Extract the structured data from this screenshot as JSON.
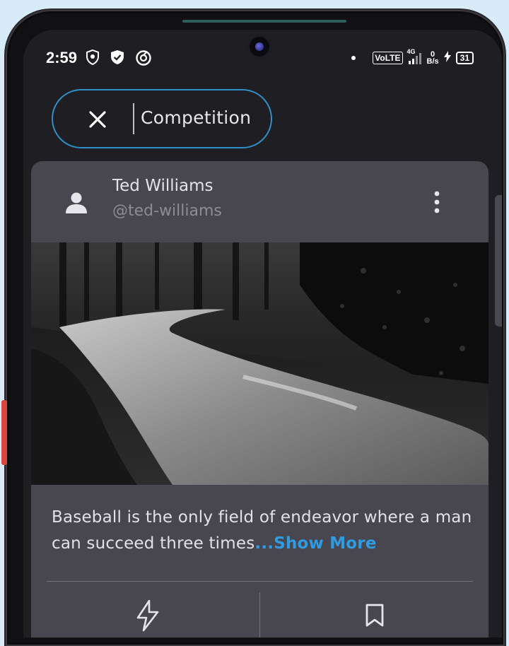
{
  "status_bar": {
    "time": "2:59",
    "network": "VoLTE",
    "signal_label": "4G",
    "net_speed_value": "0",
    "net_speed_unit": "B/s",
    "battery": "31",
    "icons": [
      "shield-icon",
      "verified-shield-icon",
      "sync-icon",
      "dot-icon",
      "signal-icon",
      "charging-icon",
      "battery-icon"
    ]
  },
  "filter_chip": {
    "label": "Competition",
    "close_icon": "close-icon"
  },
  "post": {
    "author_name": "Ted Williams",
    "author_handle": "@ted-williams",
    "text": "Baseball is the only field of endeavor where a man can succeed three times",
    "show_more": "...Show More",
    "image_description_icon": "photo",
    "actions": [
      "lightning-icon",
      "bookmark-icon"
    ]
  },
  "colors": {
    "background": "#d7ecf8",
    "screen": "#1f1e22",
    "card": "#48464f",
    "accent": "#2f8fc7",
    "link": "#2f9be0"
  }
}
